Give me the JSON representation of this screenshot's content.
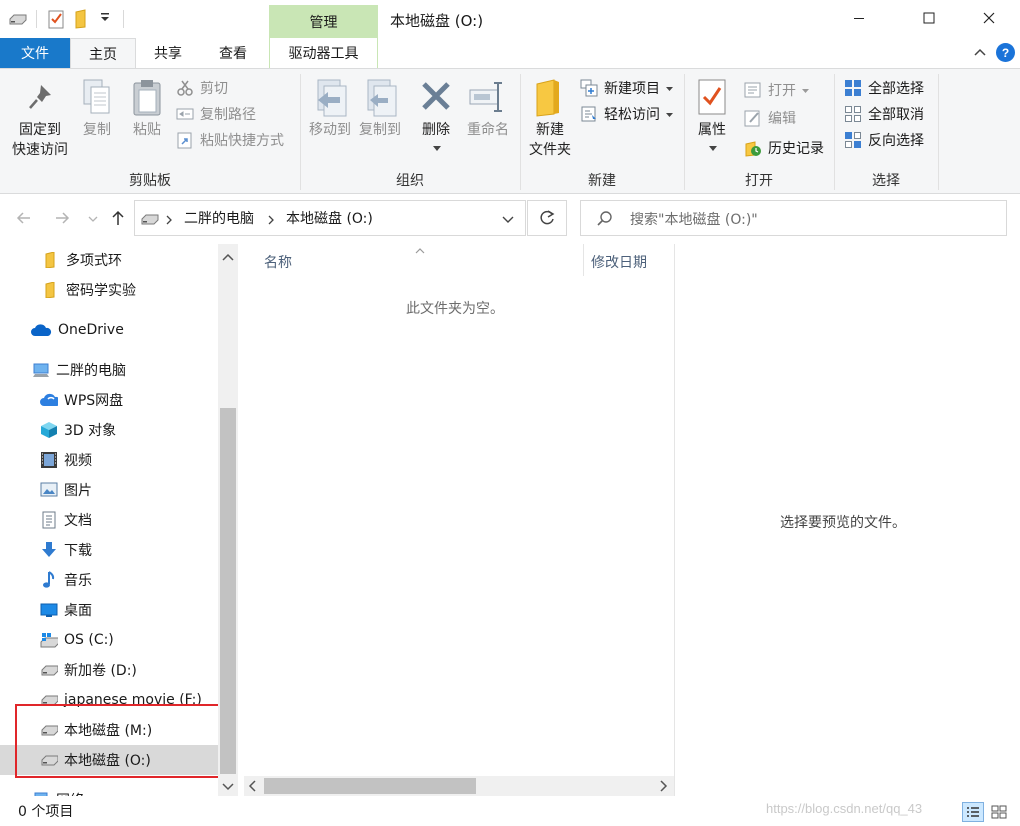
{
  "window": {
    "title": "本地磁盘 (O:)",
    "context_tab": "管理"
  },
  "ribbon_tabs": [
    {
      "label": "文件"
    },
    {
      "label": "主页"
    },
    {
      "label": "共享"
    },
    {
      "label": "查看"
    },
    {
      "label": "驱动器工具"
    }
  ],
  "ribbon": {
    "clipboard": {
      "title": "剪贴板",
      "pin_line1": "固定到",
      "pin_line2": "快速访问",
      "copy": "复制",
      "paste": "粘贴",
      "cut": "剪切",
      "copy_path": "复制路径",
      "paste_shortcut": "粘贴快捷方式"
    },
    "organize": {
      "title": "组织",
      "move_to": "移动到",
      "copy_to": "复制到",
      "delete": "删除",
      "rename": "重命名"
    },
    "new": {
      "title": "新建",
      "new_folder_line1": "新建",
      "new_folder_line2": "文件夹",
      "new_item": "新建项目",
      "easy_access": "轻松访问"
    },
    "open": {
      "title": "打开",
      "properties": "属性",
      "open": "打开",
      "edit": "编辑",
      "history": "历史记录"
    },
    "select": {
      "title": "选择",
      "select_all": "全部选择",
      "select_none": "全部取消",
      "invert": "反向选择"
    }
  },
  "address": {
    "crumbs": [
      "二胖的电脑",
      "本地磁盘 (O:)"
    ],
    "search_placeholder": "搜索\"本地磁盘 (O:)\""
  },
  "nav": {
    "items": [
      {
        "label": "多项式环",
        "icon": "folder-icon"
      },
      {
        "label": "密码学实验",
        "icon": "folder-icon"
      },
      {
        "label": "OneDrive",
        "icon": "cloud-icon"
      },
      {
        "label": "二胖的电脑",
        "icon": "computer-icon"
      },
      {
        "label": "WPS网盘",
        "icon": "wps-cloud-icon"
      },
      {
        "label": "3D 对象",
        "icon": "cube-icon"
      },
      {
        "label": "视频",
        "icon": "video-icon"
      },
      {
        "label": "图片",
        "icon": "picture-icon"
      },
      {
        "label": "文档",
        "icon": "document-icon"
      },
      {
        "label": "下载",
        "icon": "download-icon"
      },
      {
        "label": "音乐",
        "icon": "music-icon"
      },
      {
        "label": "桌面",
        "icon": "desktop-icon"
      },
      {
        "label": "OS (C:)",
        "icon": "windows-drive-icon"
      },
      {
        "label": "新加卷 (D:)",
        "icon": "drive-icon"
      },
      {
        "label": "japanese movie (F:)",
        "icon": "drive-icon"
      },
      {
        "label": "本地磁盘 (M:)",
        "icon": "drive-icon"
      },
      {
        "label": "本地磁盘 (O:)",
        "icon": "drive-icon"
      },
      {
        "label": "网络",
        "icon": "network-icon"
      }
    ]
  },
  "content": {
    "columns": [
      "名称",
      "修改日期"
    ],
    "empty_message": "此文件夹为空。"
  },
  "preview": {
    "message": "选择要预览的文件。"
  },
  "status": {
    "count": "0 个项目",
    "watermark": "https://blog.csdn.net/qq_43"
  },
  "colors": {
    "file_tab": "#1979ca",
    "context_tab": "#c9e6b5",
    "selection": "#cce8ff",
    "highlight_box": "#e0262a"
  }
}
